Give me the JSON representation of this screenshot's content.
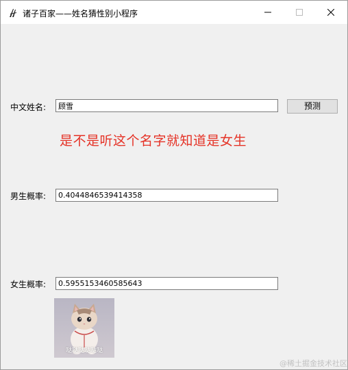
{
  "window": {
    "title": "诸子百家——姓名猜性别小程序",
    "app_icon": "feather-icon",
    "controls": [
      "minimize-icon",
      "maximize-icon",
      "close-icon"
    ]
  },
  "form": {
    "name_label": "中文姓名:",
    "name_value": "顾雪",
    "predict_button": "预测",
    "result_text": "是不是听这个名字就知道是女生",
    "male_label": "男生概率:",
    "male_value": "0.4044846539414358",
    "female_label": "女生概率:",
    "female_value": "0.5955153460585643"
  },
  "image": {
    "caption": "哒哒哒哒哒哒"
  },
  "watermark": "@稀土掘金技术社区",
  "colors": {
    "result_text": "#e53226",
    "window_bg": "#f0f0f0",
    "button_bg": "#e1e1e1"
  }
}
